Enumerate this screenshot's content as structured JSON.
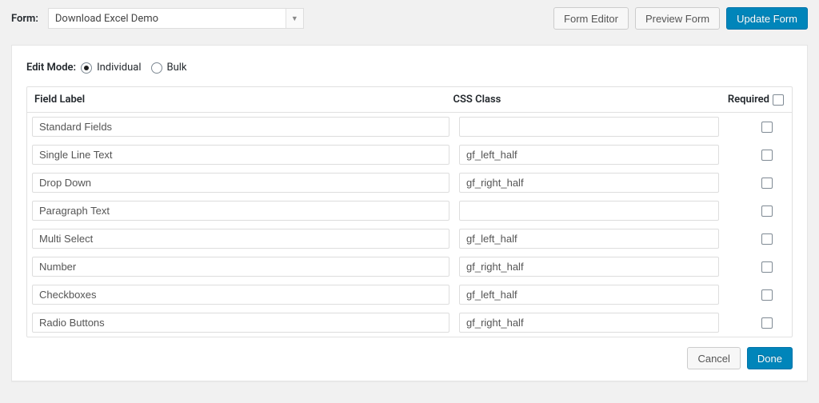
{
  "header": {
    "form_label": "Form:",
    "selected_form": "Download Excel Demo",
    "buttons": {
      "form_editor": "Form Editor",
      "preview_form": "Preview Form",
      "update_form": "Update Form"
    }
  },
  "edit_mode": {
    "label": "Edit Mode:",
    "individual": "Individual",
    "bulk": "Bulk"
  },
  "columns": {
    "field_label": "Field Label",
    "css_class": "CSS Class",
    "required": "Required"
  },
  "rows": [
    {
      "label": "Standard Fields",
      "css": ""
    },
    {
      "label": "Single Line Text",
      "css": "gf_left_half"
    },
    {
      "label": "Drop Down",
      "css": "gf_right_half"
    },
    {
      "label": "Paragraph Text",
      "css": ""
    },
    {
      "label": "Multi Select",
      "css": "gf_left_half"
    },
    {
      "label": "Number",
      "css": "gf_right_half"
    },
    {
      "label": "Checkboxes",
      "css": "gf_left_half"
    },
    {
      "label": "Radio Buttons",
      "css": "gf_right_half"
    }
  ],
  "footer": {
    "cancel": "Cancel",
    "done": "Done"
  }
}
